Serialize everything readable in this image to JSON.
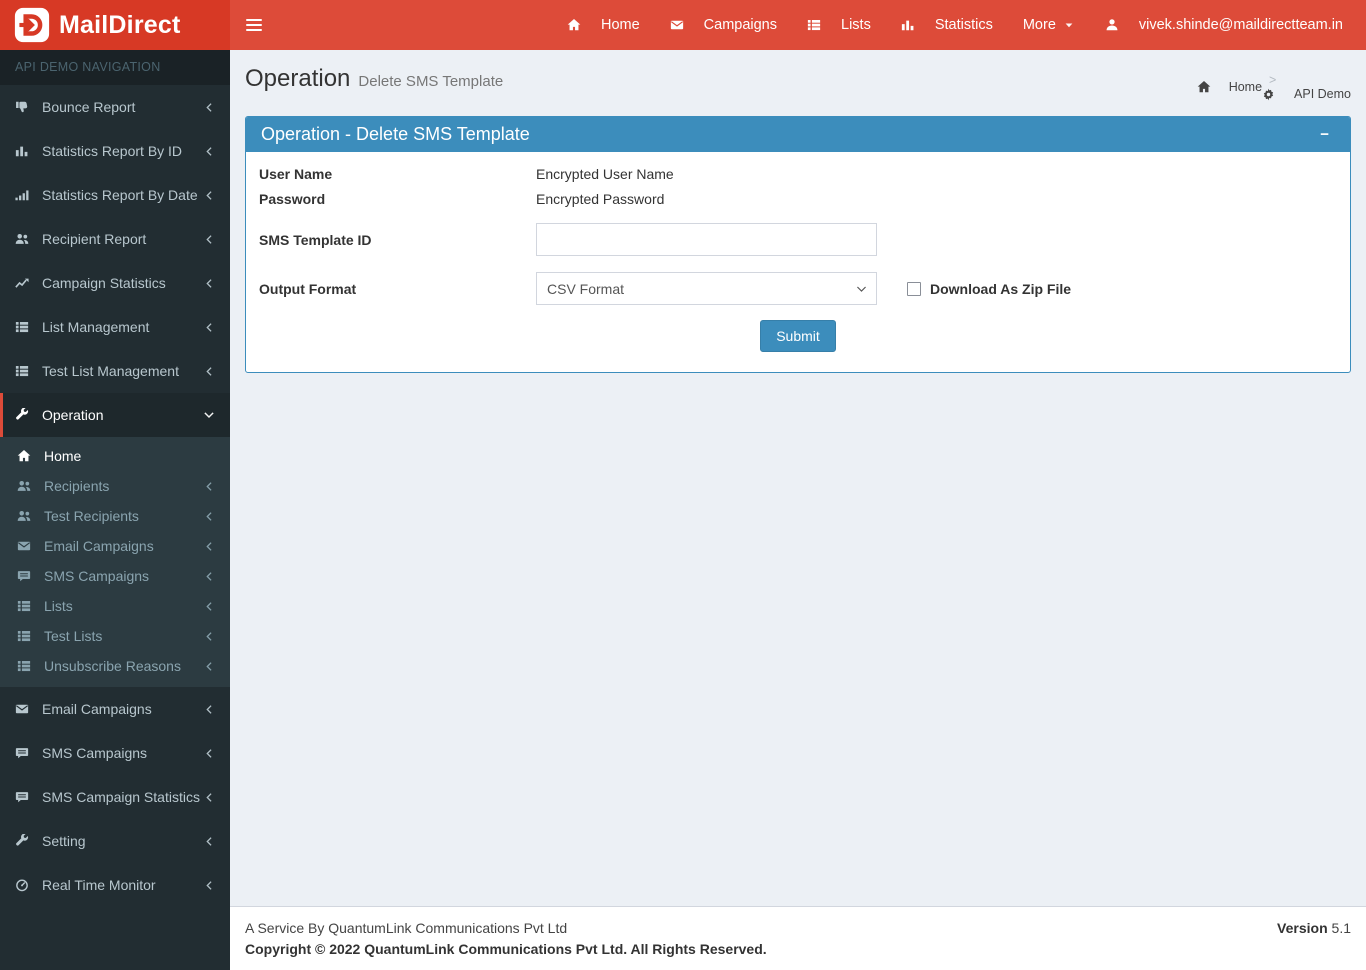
{
  "brand": {
    "name": "MailDirect"
  },
  "navbar": {
    "items": [
      {
        "label": "Home",
        "icon": "home"
      },
      {
        "label": "Campaigns",
        "icon": "envelope"
      },
      {
        "label": "Lists",
        "icon": "list"
      },
      {
        "label": "Statistics",
        "icon": "bar-chart"
      },
      {
        "label": "More",
        "icon": null,
        "caret": true
      },
      {
        "label": "vivek.shinde@maildirectteam.in",
        "icon": "user"
      }
    ]
  },
  "sidebar": {
    "header": "API DEMO NAVIGATION",
    "items": [
      {
        "label": "Bounce Report",
        "icon": "thumbs-down",
        "chevron": "left"
      },
      {
        "label": "Statistics Report By ID",
        "icon": "bar-chart",
        "chevron": "left"
      },
      {
        "label": "Statistics Report By Date",
        "icon": "signal",
        "chevron": "left"
      },
      {
        "label": "Recipient Report",
        "icon": "users",
        "chevron": "left"
      },
      {
        "label": "Campaign Statistics",
        "icon": "line-chart",
        "chevron": "left"
      },
      {
        "label": "List Management",
        "icon": "list",
        "chevron": "left"
      },
      {
        "label": "Test List Management",
        "icon": "list",
        "chevron": "left"
      },
      {
        "label": "Operation",
        "icon": "wrench",
        "chevron": "down",
        "active": true,
        "children": [
          {
            "label": "Home",
            "icon": "home",
            "active": true
          },
          {
            "label": "Recipients",
            "icon": "users",
            "chevron": "left"
          },
          {
            "label": "Test Recipients",
            "icon": "users",
            "chevron": "left"
          },
          {
            "label": "Email Campaigns",
            "icon": "envelope",
            "chevron": "left"
          },
          {
            "label": "SMS Campaigns",
            "icon": "comment",
            "chevron": "left"
          },
          {
            "label": "Lists",
            "icon": "list",
            "chevron": "left"
          },
          {
            "label": "Test Lists",
            "icon": "list",
            "chevron": "left"
          },
          {
            "label": "Unsubscribe Reasons",
            "icon": "list",
            "chevron": "left"
          }
        ]
      },
      {
        "label": "Email Campaigns",
        "icon": "envelope",
        "chevron": "left"
      },
      {
        "label": "SMS Campaigns",
        "icon": "comment",
        "chevron": "left"
      },
      {
        "label": "SMS Campaign Statistics",
        "icon": "comment",
        "chevron": "left"
      },
      {
        "label": "Setting",
        "icon": "wrench",
        "chevron": "left"
      },
      {
        "label": "Real Time Monitor",
        "icon": "gauge",
        "chevron": "left"
      }
    ]
  },
  "page": {
    "title": "Operation",
    "subtitle": "Delete SMS Template",
    "breadcrumb": [
      {
        "label": "Home",
        "icon": "home"
      },
      {
        "label": "API Demo",
        "icon": "gear"
      }
    ]
  },
  "panel": {
    "title": "Operation - Delete SMS Template",
    "collapse_icon": "−"
  },
  "form": {
    "username_label": "User Name",
    "username_value": "Encrypted User Name",
    "password_label": "Password",
    "password_value": "Encrypted Password",
    "template_id_label": "SMS Template ID",
    "template_id_value": "",
    "output_format_label": "Output Format",
    "output_format_value": "CSV Format",
    "zip_label": "Download As Zip File",
    "zip_checked": false,
    "submit_label": "Submit"
  },
  "footer": {
    "service_line": "A Service By QuantumLink Communications Pvt Ltd",
    "copyright_line": "Copyright © 2022 QuantumLink Communications Pvt Ltd. All Rights Reserved.",
    "version_label": "Version",
    "version_value": "5.1"
  },
  "colors": {
    "header_red": "#dd4b39",
    "logo_red": "#d73925",
    "sidebar_bg": "#222d32",
    "submenu_bg": "#2c3b41",
    "accent_blue": "#3c8dbc",
    "content_bg": "#ecf0f5"
  }
}
